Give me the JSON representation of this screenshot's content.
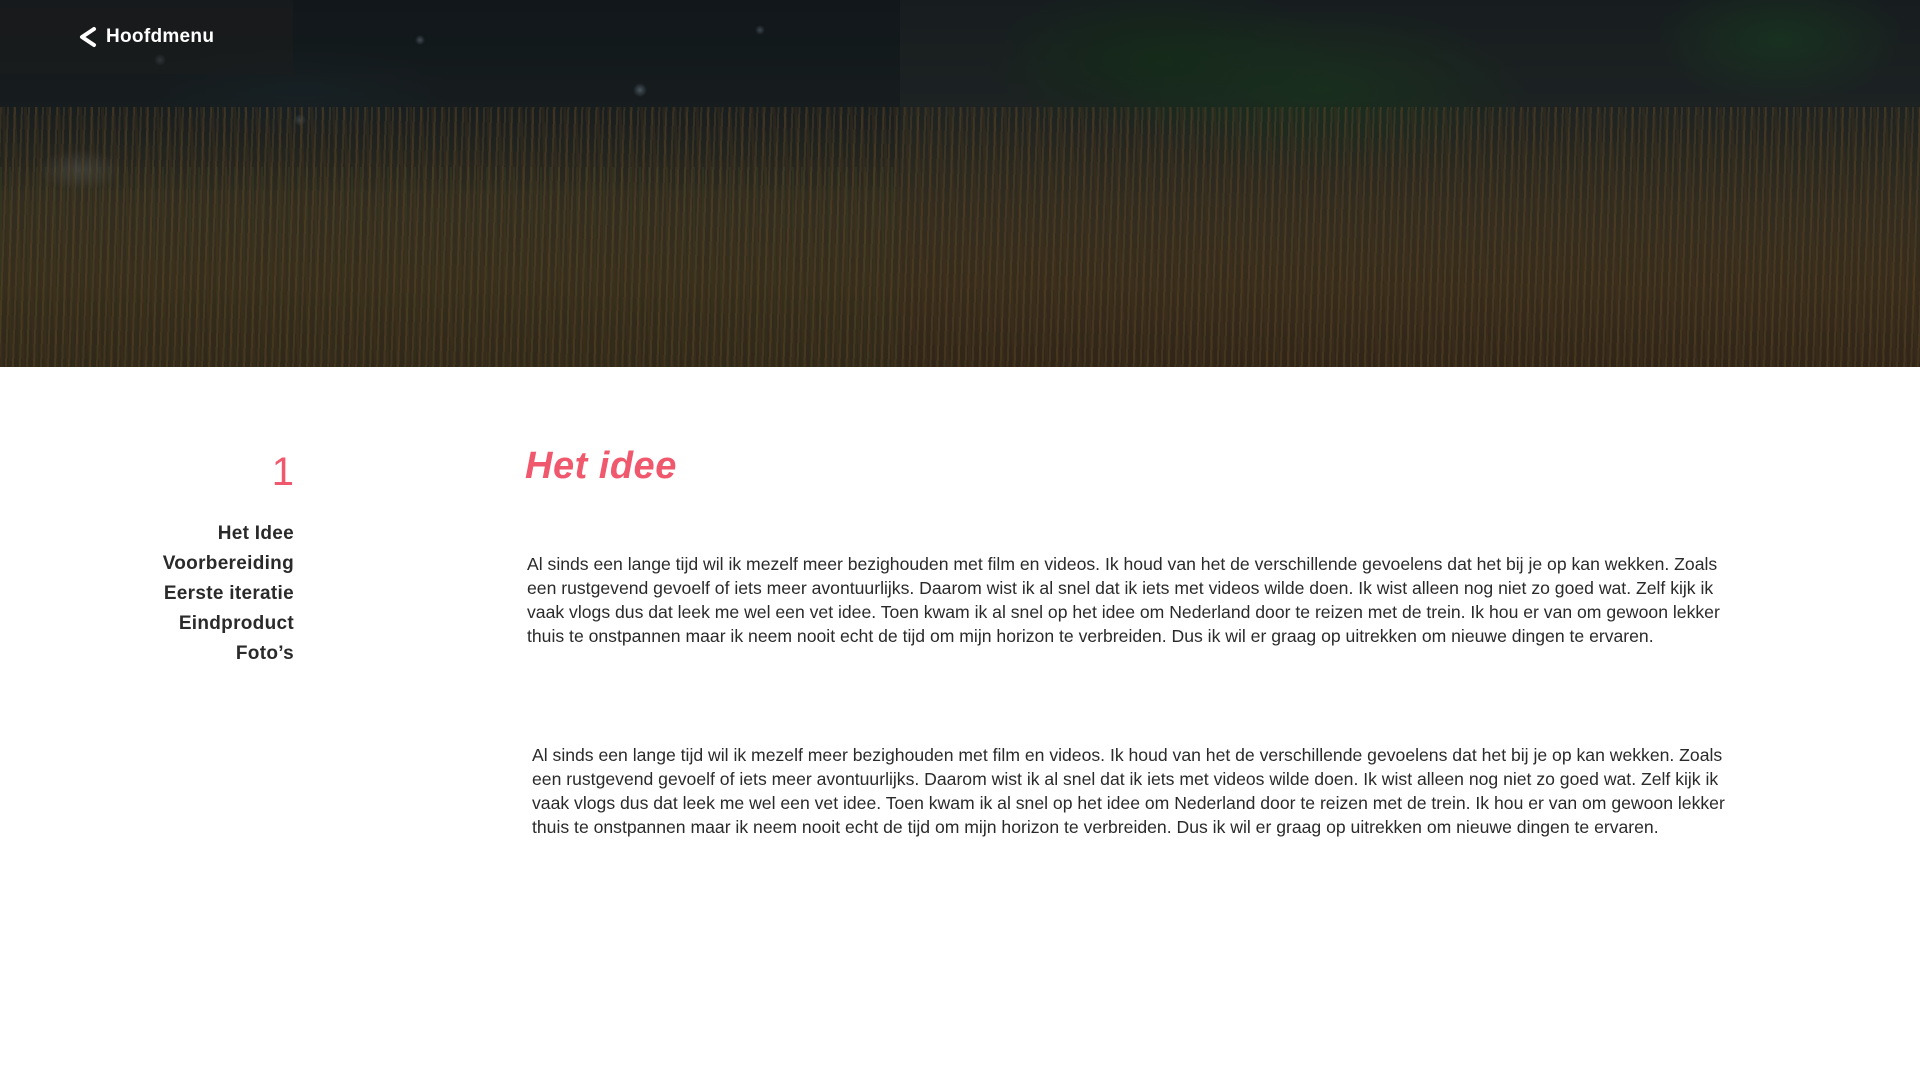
{
  "nav": {
    "back_label": "Hoofdmenu"
  },
  "sidebar": {
    "chapter_number": "1",
    "items": [
      {
        "label": "Het Idee"
      },
      {
        "label": "Voorbereiding"
      },
      {
        "label": "Eerste iteratie"
      },
      {
        "label": "Eindproduct"
      },
      {
        "label": "Foto’s"
      }
    ]
  },
  "main": {
    "title": "Het idee",
    "paragraphs": [
      "Al sinds een lange tijd wil ik mezelf meer bezighouden met film en videos. Ik houd van het de verschillende gevoelens dat het bij je op kan wekken. Zoals een rustgevend gevoelf of iets meer avontuurlijks. Daarom wist ik al snel dat ik iets met videos wilde doen. Ik wist alleen nog niet zo goed wat. Zelf kijk ik vaak vlogs dus dat leek me wel een vet idee. Toen kwam ik al snel op het idee om Nederland door te reizen met de trein. Ik hou er van om gewoon lekker thuis te onstpannen maar ik neem nooit echt de tijd om mijn horizon te verbreiden. Dus ik wil er graag op uitrekken om nieuwe dingen te ervaren.",
      "Al sinds een lange tijd wil ik mezelf meer bezighouden met film en videos. Ik houd van het de verschillende gevoelens dat het bij je op kan wekken. Zoals een rustgevend gevoelf of iets meer avontuurlijks. Daarom wist ik al snel dat ik iets met videos wilde doen. Ik wist alleen nog niet zo goed wat. Zelf kijk ik vaak vlogs dus dat leek me wel een vet idee. Toen kwam ik al snel op het idee om Nederland door te reizen met de trein. Ik hou er van om gewoon lekker thuis te onstpannen maar ik neem nooit echt de tijd om mijn horizon te verbreiden. Dus ik wil er graag op uitrekken om nieuwe dingen te ervaren."
    ]
  },
  "colors": {
    "accent": "#f0586e",
    "text": "#2a2a2a",
    "background": "#ffffff"
  },
  "icons": {
    "back": "chevron-left-icon"
  }
}
